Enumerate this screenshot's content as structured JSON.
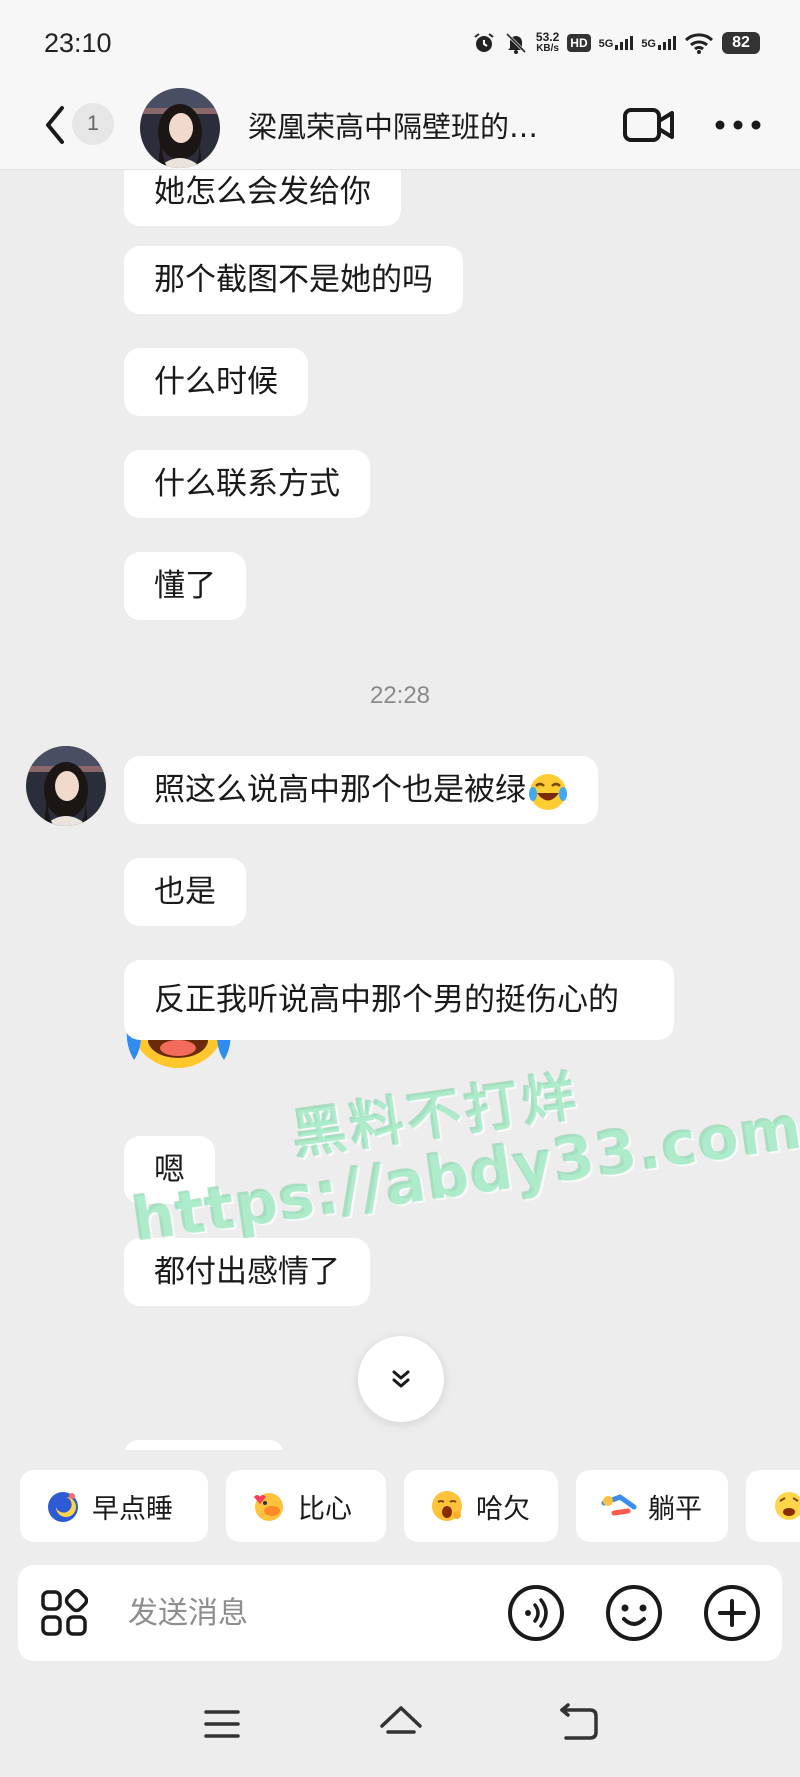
{
  "status_bar": {
    "time": "23:10",
    "net_speed_value": "53.2",
    "net_speed_unit": "KB/s",
    "hd_label": "HD",
    "sig1_label": "5G",
    "sig2_label": "5G",
    "battery": "82",
    "icons": [
      "alarm-icon",
      "mute-icon",
      "hd-icon",
      "signal-icon",
      "signal-icon",
      "wifi-icon",
      "battery-icon"
    ]
  },
  "header": {
    "unread_count": "1",
    "title": "梁凰荣高中隔壁班的…",
    "icons": [
      "back-icon",
      "video-call-icon",
      "more-icon"
    ]
  },
  "messages": [
    {
      "text": "她怎么会发给你"
    },
    {
      "text": "那个截图不是她的吗"
    },
    {
      "text": "什么时候"
    },
    {
      "text": "什么联系方式"
    },
    {
      "text": "懂了"
    },
    {
      "text": "照这么说高中那个也是被绿",
      "emoji": "laughing-crying-emoji"
    },
    {
      "text": "也是"
    },
    {
      "sticker": "facepalm-crying-emoji"
    },
    {
      "text": "反正我听说高中那个男的挺伤心的"
    },
    {
      "text": "嗯"
    },
    {
      "text": "都付出感情了"
    }
  ],
  "time_divider": "22:28",
  "watermark": {
    "line1": "黑料不打烊",
    "line2": "https://abdy33.com"
  },
  "quick_replies": [
    {
      "label": "早点睡",
      "icon": "moon-sleep-icon"
    },
    {
      "label": "比心",
      "icon": "duck-heart-icon"
    },
    {
      "label": "哈欠",
      "icon": "yawn-icon"
    },
    {
      "label": "躺平",
      "icon": "lie-flat-icon"
    }
  ],
  "input": {
    "placeholder": "发送消息"
  },
  "colors": {
    "background": "#ededed",
    "bubble": "#ffffff",
    "watermark": "#96e8be"
  }
}
